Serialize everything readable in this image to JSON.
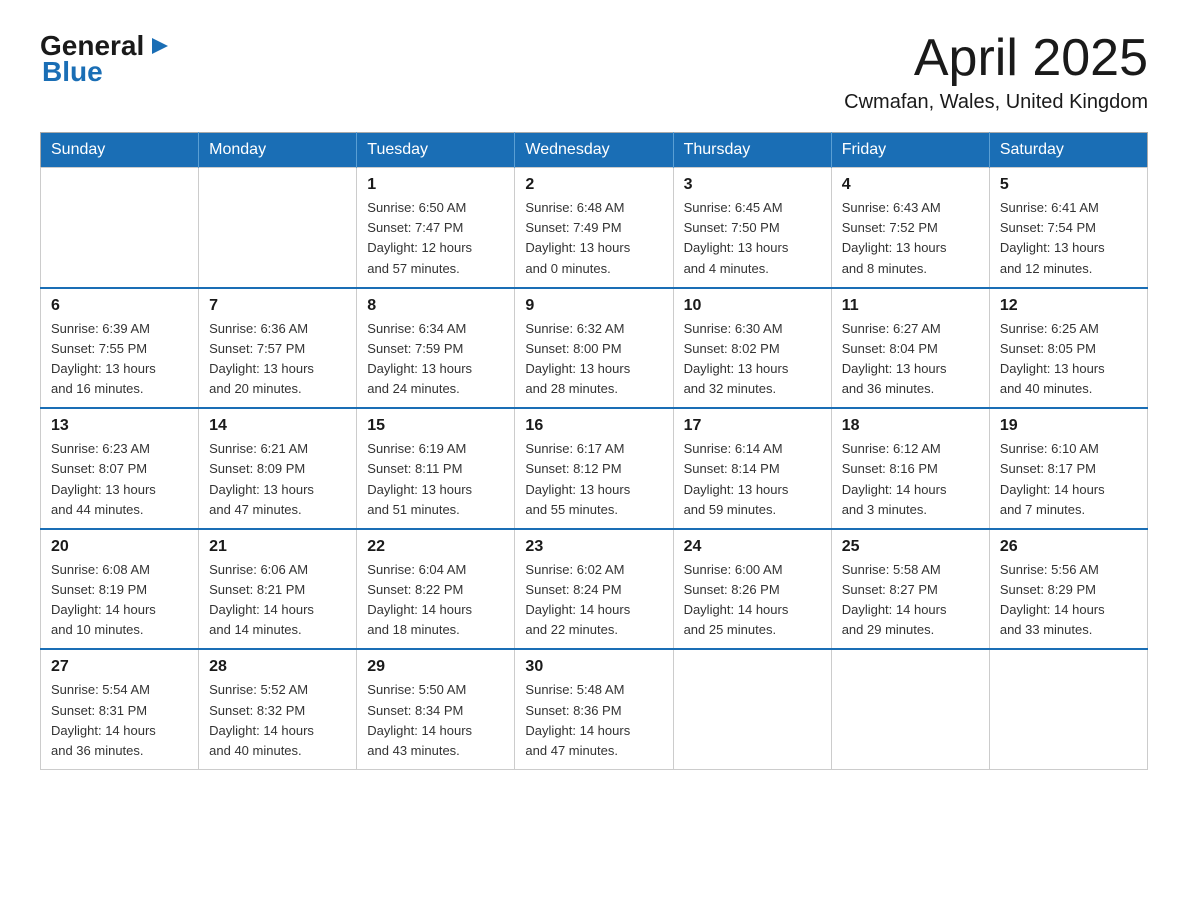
{
  "header": {
    "logo_general": "General",
    "logo_blue": "Blue",
    "title": "April 2025",
    "subtitle": "Cwmafan, Wales, United Kingdom"
  },
  "days_of_week": [
    "Sunday",
    "Monday",
    "Tuesday",
    "Wednesday",
    "Thursday",
    "Friday",
    "Saturday"
  ],
  "weeks": [
    [
      {
        "day": "",
        "info": ""
      },
      {
        "day": "",
        "info": ""
      },
      {
        "day": "1",
        "info": "Sunrise: 6:50 AM\nSunset: 7:47 PM\nDaylight: 12 hours\nand 57 minutes."
      },
      {
        "day": "2",
        "info": "Sunrise: 6:48 AM\nSunset: 7:49 PM\nDaylight: 13 hours\nand 0 minutes."
      },
      {
        "day": "3",
        "info": "Sunrise: 6:45 AM\nSunset: 7:50 PM\nDaylight: 13 hours\nand 4 minutes."
      },
      {
        "day": "4",
        "info": "Sunrise: 6:43 AM\nSunset: 7:52 PM\nDaylight: 13 hours\nand 8 minutes."
      },
      {
        "day": "5",
        "info": "Sunrise: 6:41 AM\nSunset: 7:54 PM\nDaylight: 13 hours\nand 12 minutes."
      }
    ],
    [
      {
        "day": "6",
        "info": "Sunrise: 6:39 AM\nSunset: 7:55 PM\nDaylight: 13 hours\nand 16 minutes."
      },
      {
        "day": "7",
        "info": "Sunrise: 6:36 AM\nSunset: 7:57 PM\nDaylight: 13 hours\nand 20 minutes."
      },
      {
        "day": "8",
        "info": "Sunrise: 6:34 AM\nSunset: 7:59 PM\nDaylight: 13 hours\nand 24 minutes."
      },
      {
        "day": "9",
        "info": "Sunrise: 6:32 AM\nSunset: 8:00 PM\nDaylight: 13 hours\nand 28 minutes."
      },
      {
        "day": "10",
        "info": "Sunrise: 6:30 AM\nSunset: 8:02 PM\nDaylight: 13 hours\nand 32 minutes."
      },
      {
        "day": "11",
        "info": "Sunrise: 6:27 AM\nSunset: 8:04 PM\nDaylight: 13 hours\nand 36 minutes."
      },
      {
        "day": "12",
        "info": "Sunrise: 6:25 AM\nSunset: 8:05 PM\nDaylight: 13 hours\nand 40 minutes."
      }
    ],
    [
      {
        "day": "13",
        "info": "Sunrise: 6:23 AM\nSunset: 8:07 PM\nDaylight: 13 hours\nand 44 minutes."
      },
      {
        "day": "14",
        "info": "Sunrise: 6:21 AM\nSunset: 8:09 PM\nDaylight: 13 hours\nand 47 minutes."
      },
      {
        "day": "15",
        "info": "Sunrise: 6:19 AM\nSunset: 8:11 PM\nDaylight: 13 hours\nand 51 minutes."
      },
      {
        "day": "16",
        "info": "Sunrise: 6:17 AM\nSunset: 8:12 PM\nDaylight: 13 hours\nand 55 minutes."
      },
      {
        "day": "17",
        "info": "Sunrise: 6:14 AM\nSunset: 8:14 PM\nDaylight: 13 hours\nand 59 minutes."
      },
      {
        "day": "18",
        "info": "Sunrise: 6:12 AM\nSunset: 8:16 PM\nDaylight: 14 hours\nand 3 minutes."
      },
      {
        "day": "19",
        "info": "Sunrise: 6:10 AM\nSunset: 8:17 PM\nDaylight: 14 hours\nand 7 minutes."
      }
    ],
    [
      {
        "day": "20",
        "info": "Sunrise: 6:08 AM\nSunset: 8:19 PM\nDaylight: 14 hours\nand 10 minutes."
      },
      {
        "day": "21",
        "info": "Sunrise: 6:06 AM\nSunset: 8:21 PM\nDaylight: 14 hours\nand 14 minutes."
      },
      {
        "day": "22",
        "info": "Sunrise: 6:04 AM\nSunset: 8:22 PM\nDaylight: 14 hours\nand 18 minutes."
      },
      {
        "day": "23",
        "info": "Sunrise: 6:02 AM\nSunset: 8:24 PM\nDaylight: 14 hours\nand 22 minutes."
      },
      {
        "day": "24",
        "info": "Sunrise: 6:00 AM\nSunset: 8:26 PM\nDaylight: 14 hours\nand 25 minutes."
      },
      {
        "day": "25",
        "info": "Sunrise: 5:58 AM\nSunset: 8:27 PM\nDaylight: 14 hours\nand 29 minutes."
      },
      {
        "day": "26",
        "info": "Sunrise: 5:56 AM\nSunset: 8:29 PM\nDaylight: 14 hours\nand 33 minutes."
      }
    ],
    [
      {
        "day": "27",
        "info": "Sunrise: 5:54 AM\nSunset: 8:31 PM\nDaylight: 14 hours\nand 36 minutes."
      },
      {
        "day": "28",
        "info": "Sunrise: 5:52 AM\nSunset: 8:32 PM\nDaylight: 14 hours\nand 40 minutes."
      },
      {
        "day": "29",
        "info": "Sunrise: 5:50 AM\nSunset: 8:34 PM\nDaylight: 14 hours\nand 43 minutes."
      },
      {
        "day": "30",
        "info": "Sunrise: 5:48 AM\nSunset: 8:36 PM\nDaylight: 14 hours\nand 47 minutes."
      },
      {
        "day": "",
        "info": ""
      },
      {
        "day": "",
        "info": ""
      },
      {
        "day": "",
        "info": ""
      }
    ]
  ],
  "colors": {
    "header_bg": "#1a6eb5",
    "header_text": "#ffffff",
    "border": "#cccccc",
    "row_divider": "#1a6eb5"
  }
}
